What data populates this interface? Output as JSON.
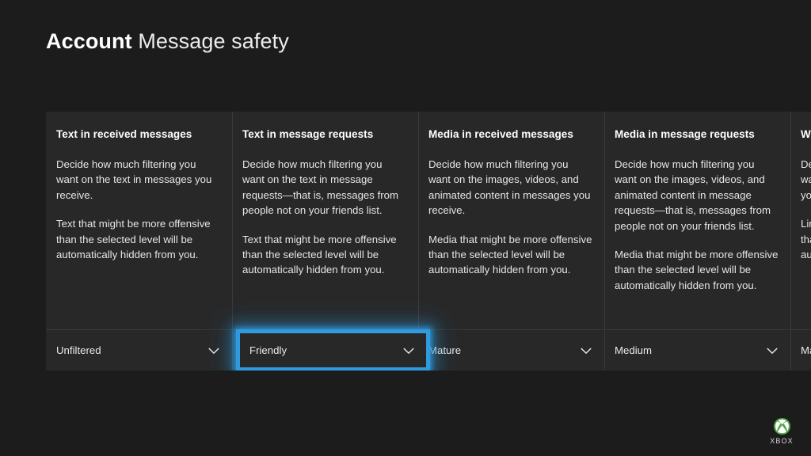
{
  "header": {
    "title_strong": "Account",
    "title_rest": "Message safety"
  },
  "cards": [
    {
      "title": "Text in received messages",
      "paragraphs": [
        "Decide how much filtering you want on the text in messages you receive.",
        "Text that might be more offensive than the selected level will be automatically hidden from you."
      ],
      "dropdown": {
        "value": "Unfiltered",
        "icon": "chevron-down-icon",
        "focused": false
      }
    },
    {
      "title": "Text in message requests",
      "paragraphs": [
        "Decide how much filtering you want on the text in message requests—that is, messages from people not on your friends list.",
        "Text that might be more offensive than the selected level will be automatically hidden from you."
      ],
      "dropdown": {
        "value": "Friendly",
        "icon": "chevron-down-icon",
        "focused": true
      }
    },
    {
      "title": "Media in received messages",
      "paragraphs": [
        "Decide how much filtering you want on the images, videos, and animated content in messages you receive.",
        "Media that might be more offensive than the selected level will be automatically hidden from you."
      ],
      "dropdown": {
        "value": "Mature",
        "icon": "chevron-down-icon",
        "focused": false
      }
    },
    {
      "title": "Media in message requests",
      "paragraphs": [
        "Decide how much filtering you want on the images, videos, and animated content in message requests—that is, messages from people not on your friends list.",
        "Media that might be more offensive than the selected level will be automatically hidden from you."
      ],
      "dropdown": {
        "value": "Medium",
        "icon": "chevron-down-icon",
        "focused": false
      }
    },
    {
      "title": "Web links",
      "paragraphs": [
        "Decide how much filtering you want on the web links in messages you receive.",
        "Links that might be more offensive than the selected level will be automatically hidden from you."
      ],
      "dropdown": {
        "value": "Mature",
        "icon": "chevron-down-icon",
        "focused": false
      }
    }
  ],
  "branding": {
    "wordmark": "XBOX",
    "logo_icon": "xbox-sphere-icon"
  },
  "colors": {
    "page_background": "#1c1c1c",
    "card_background": "#282828",
    "divider": "#3a3a3a",
    "focus_accent": "#2f9ade",
    "xbox_green": "#52a447",
    "text_primary": "#ffffff",
    "text_body": "#e6e6e6"
  }
}
